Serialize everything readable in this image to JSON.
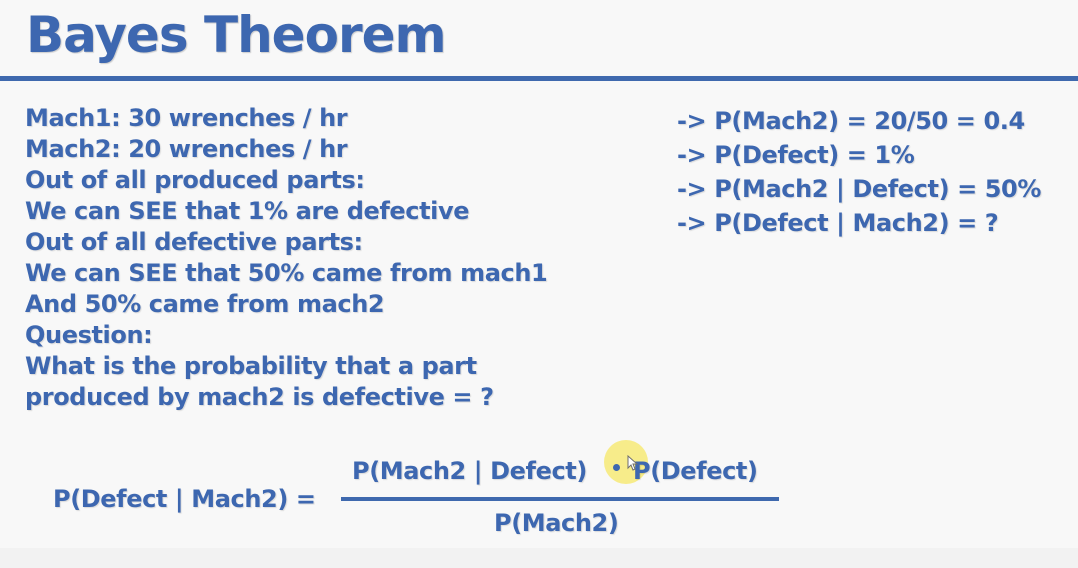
{
  "slide": {
    "title": "Bayes Theorem",
    "left_lines": [
      "Mach1: 30 wrenches / hr",
      "Mach2: 20 wrenches / hr",
      "Out of all produced parts:",
      "We can SEE that 1% are defective",
      "Out of all defective parts:",
      "We can SEE that 50% came from mach1",
      "And 50% came from mach2",
      "Question:",
      "What is the probability that a part",
      "produced by mach2 is defective = ?"
    ],
    "right_lines": [
      "-> P(Mach2) = 20/50 = 0.4",
      "-> P(Defect) = 1%",
      "-> P(Mach2 | Defect) = 50%",
      "-> P(Defect | Mach2) = ?"
    ],
    "formula": {
      "lhs": "P(Defect | Mach2) =",
      "numerator_left": "P(Mach2 | Defect)",
      "numerator_right": "P(Defect)",
      "denominator": "P(Mach2)"
    }
  },
  "colors": {
    "accent_blue": "#3d67b0",
    "background": "#f8f8f8",
    "cursor_highlight": "#f6e75f"
  },
  "icons": {
    "cursor": "mouse-pointer-icon"
  }
}
